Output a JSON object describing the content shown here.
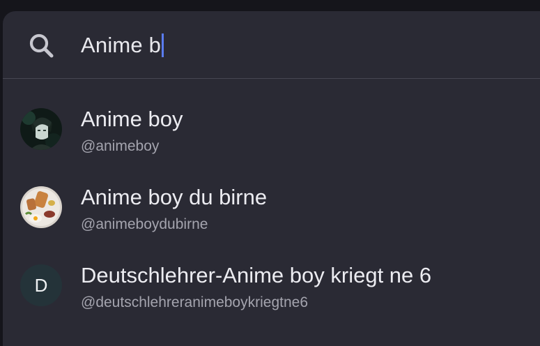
{
  "search": {
    "query": "Anime b",
    "icon": "search-icon"
  },
  "colors": {
    "panel_background": "#2a2a34",
    "caret": "#5a7cf0",
    "primary_text": "#ececf1",
    "secondary_text": "#a4a4ae"
  },
  "results": [
    {
      "name": "Anime boy",
      "handle": "@animeboy",
      "avatar": "photo-avatar-anime-character"
    },
    {
      "name": "Anime boy du birne",
      "handle": "@animeboydubirne",
      "avatar": "photo-avatar-food-plate"
    },
    {
      "name": "Deutschlehrer-Anime boy kriegt ne 6",
      "handle": "@deutschlehreranimeboykriegtne6",
      "avatar_letter": "D"
    }
  ]
}
